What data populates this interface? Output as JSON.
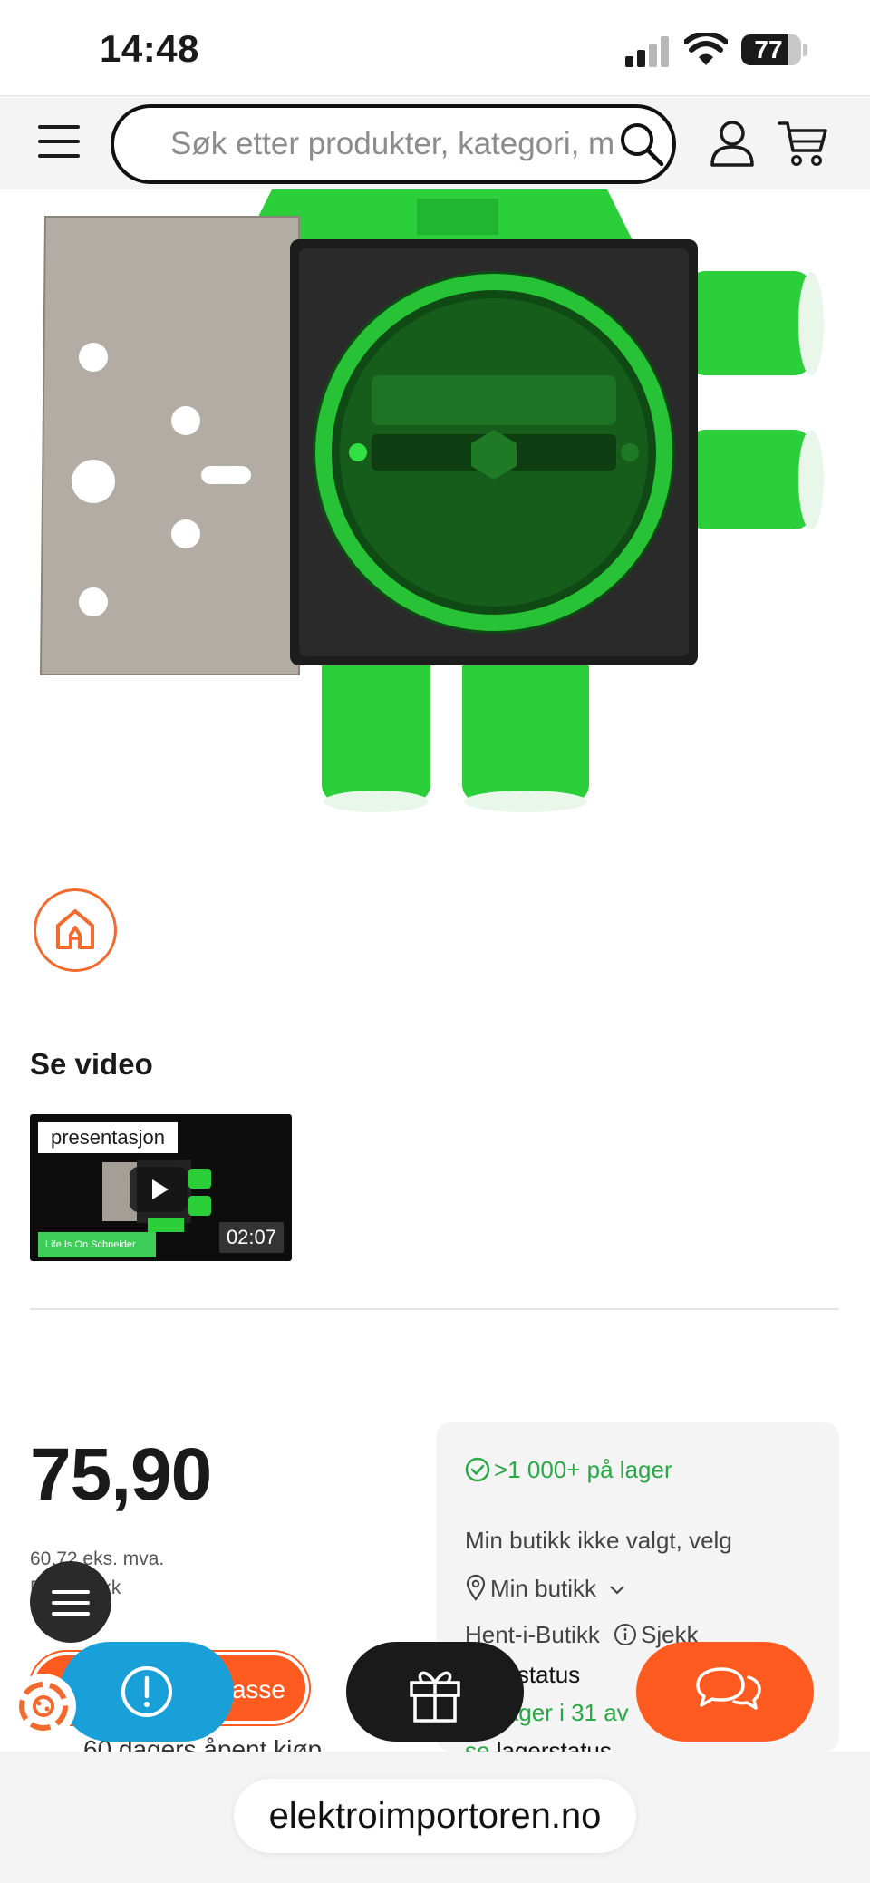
{
  "status_bar": {
    "time": "14:48",
    "battery": "77",
    "battery_level": 0.77
  },
  "header": {
    "search_placeholder": "Søk etter produkter, kategori, merke"
  },
  "product": {
    "video_heading": "Se video",
    "video": {
      "label": "presentasjon",
      "duration": "02:07",
      "brand": "Life Is On  Schneider"
    },
    "price": "75,90",
    "price_ex_vat": "60,72 eks. mva.",
    "unit": "Pr. 1 Stykk",
    "add_to_cart_label": "kasse",
    "open_purchase": "60 dagers åpent kjøp"
  },
  "stock": {
    "in_stock": ">1 000+ på lager",
    "store_not_selected": "Min butikk ikke valgt, velg",
    "my_store": "Min butikk",
    "pickup": "Hent-i-Butikk",
    "check": "Sjekk",
    "status": "lagerstatus",
    "in_stores": "På lager i 31 av",
    "see": "se",
    "see_status": "lagerstatus"
  },
  "browser": {
    "url": "elektroimportoren.no"
  },
  "colors": {
    "accent": "#ff5a1f",
    "stock_green": "#2aa845",
    "info_blue": "#1aa0d8",
    "product_green": "#2ed43a"
  }
}
